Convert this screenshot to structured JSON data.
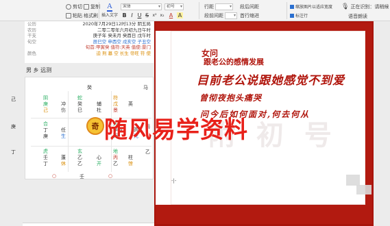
{
  "ribbon": {
    "clipboard": {
      "paste_label": "粘贴",
      "cut_label": "剪切",
      "copy_label": "复制",
      "format_painter_label": "格式刷"
    },
    "insert_label": "插入文字",
    "font": {
      "family": "宋体",
      "size": "初号"
    },
    "bold": "B",
    "italic": "I",
    "underline": "U",
    "strike": "S",
    "superscript": "x²",
    "subscript": "x₂",
    "font_color_glyph": "A",
    "highlight_glyph": "A",
    "spacing": {
      "line_label": "行距",
      "before_label": "段前间距",
      "after_label": "段后间距",
      "first_indent_label": "首行缩进"
    },
    "checkboxes": [
      {
        "label": "缩放图片以适应宽度",
        "checked": true
      },
      {
        "label": "标注行",
        "checked": true
      }
    ],
    "voice_label": "语音朗读",
    "top_right_text": "正在识别：请稍候"
  },
  "info_panel": {
    "rows": [
      {
        "label": "公历",
        "value": "2020年7月29日12时13分 阴五局"
      },
      {
        "label": "农历",
        "value": "二零二零年六月初九日午时"
      },
      {
        "label": "干支",
        "value": "庚子年 癸未月 癸酉日 戊午时"
      },
      {
        "label": "旬空",
        "value": "辰巳空 申酉空 戌亥空 子丑空"
      },
      {
        "label": "",
        "value": "旬首:甲寅癸 值符:天英 值使:景门"
      },
      {
        "label": "颜色",
        "value": "迫 刑 墓 空 长生 帝旺 符 使"
      }
    ]
  },
  "chart_section": {
    "heading": "男 乡 远测",
    "top_label": "癸",
    "side_labels": {
      "top_left": "己",
      "mid_left": "庚",
      "bottom_left": "丁",
      "top_right": "马",
      "mid_right": "丙",
      "bottom_right": "乙"
    },
    "palaces": [
      {
        "lines": [
          "阴",
          "庚",
          "己"
        ],
        "inner": [
          "冲",
          "伤"
        ]
      },
      {
        "lines": [
          "蛇",
          "癸",
          "巳"
        ],
        "inner": [
          "辅",
          "杜"
        ]
      },
      {
        "lines": [
          "符",
          "戊",
          "景"
        ],
        "inner": [
          "英",
          ""
        ]
      },
      {
        "lines": [
          "合",
          "丁",
          "庚"
        ],
        "inner": [
          "任",
          "生"
        ]
      },
      {
        "lines": [
          "",
          "",
          ""
        ],
        "inner": [
          "",
          ""
        ]
      },
      {
        "lines": [
          "天",
          "辛戊",
          "丙"
        ],
        "inner": [
          "芮",
          "死"
        ]
      },
      {
        "lines": [
          "虎",
          "壬",
          "丁"
        ],
        "inner": [
          "蓬",
          "休"
        ]
      },
      {
        "lines": [
          "玄",
          "乙",
          "乙"
        ],
        "inner": [
          "心",
          "开"
        ]
      },
      {
        "lines": [
          "地",
          "丙",
          "乙"
        ],
        "inner": [
          "柱",
          "惊"
        ]
      }
    ],
    "center_badge": "奇",
    "bottom_markers": [
      "○",
      "壬",
      "○"
    ]
  },
  "document": {
    "line1": "女问",
    "line2": "跟老公的感情发展",
    "line3": "目前老公说跟她感觉不到爱",
    "line4": "曾彻夜抱头痛哭",
    "line5": "问今后如何面对,何去何从",
    "cursor": "-|-",
    "ghost_text": "附 初 号"
  },
  "overlay_watermark": "随风易学资料",
  "colors": {
    "frame_red": "#b21a10",
    "text_red": "#b0150c",
    "watermark_red": "#e8211a",
    "accent_blue": "#2a6fd0"
  }
}
